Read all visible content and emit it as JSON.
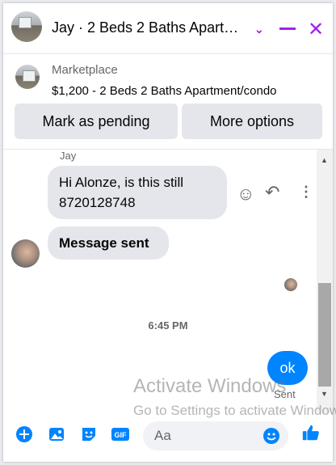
{
  "header": {
    "title": "Jay · 2 Beds 2 Baths Apart…",
    "chevron_icon": "chevron-down-icon",
    "minimize_icon": "minus-icon",
    "close_icon": "close-icon",
    "accent_color": "#a020f0"
  },
  "marketplace": {
    "label": "Marketplace",
    "listing": "$1,200 - 2 Beds 2 Baths Apartment/condo"
  },
  "actions": {
    "mark_pending": "Mark as pending",
    "more_options": "More options"
  },
  "conversation": {
    "sender_name": "Jay",
    "incoming_message": "Hi Alonze, is this still 8720128748",
    "second_message": "Message sent",
    "timestamp": "6:45 PM",
    "outgoing_message": "ok",
    "status": "Sent"
  },
  "watermark": {
    "line1": "Activate Windows",
    "line2": "Go to Settings to activate Windows."
  },
  "composer": {
    "placeholder": "Aa",
    "brand_color": "#0084ff"
  }
}
